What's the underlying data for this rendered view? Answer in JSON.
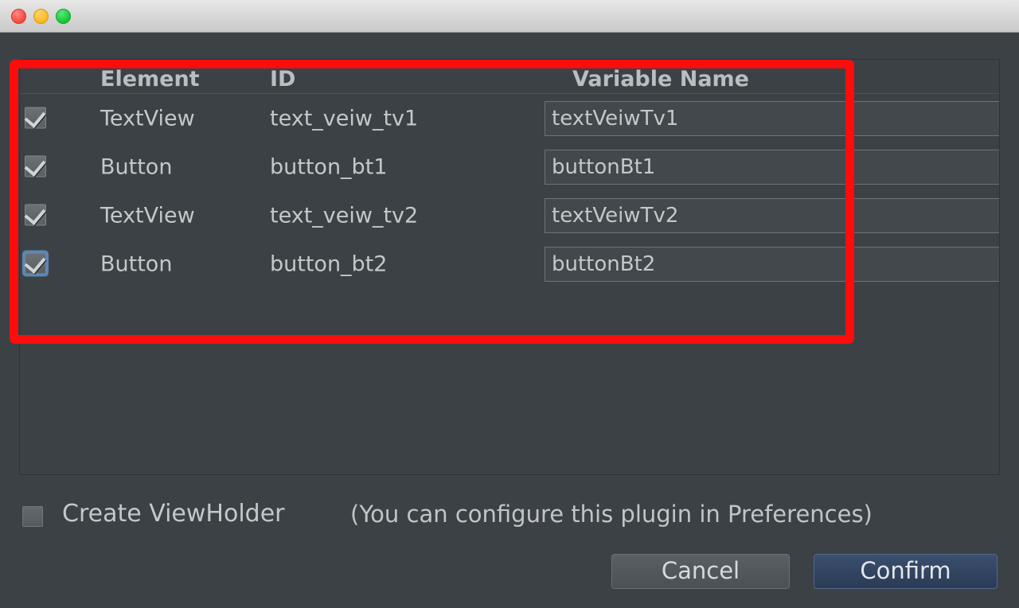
{
  "window": {
    "titlebar": {
      "close_label": "close",
      "minimize_label": "minimize",
      "zoom_label": "zoom"
    }
  },
  "table": {
    "columns": [
      "Element",
      "ID",
      "Variable Name"
    ],
    "rows": [
      {
        "checked": true,
        "focused": false,
        "element": "TextView",
        "id": "text_veiw_tv1",
        "variable": "textVeiwTv1"
      },
      {
        "checked": true,
        "focused": false,
        "element": "Button",
        "id": "button_bt1",
        "variable": "buttonBt1"
      },
      {
        "checked": true,
        "focused": false,
        "element": "TextView",
        "id": "text_veiw_tv2",
        "variable": "textVeiwTv2"
      },
      {
        "checked": true,
        "focused": true,
        "element": "Button",
        "id": "button_bt2",
        "variable": "buttonBt2"
      }
    ]
  },
  "options": {
    "create_viewholder_label": "Create ViewHolder",
    "create_viewholder_checked": false,
    "hint": "(You can configure this plugin in Preferences)"
  },
  "buttons": {
    "cancel_label": "Cancel",
    "confirm_label": "Confirm"
  },
  "annotation": {
    "color": "#fb0d0d"
  },
  "colors": {
    "dialog_background": "#3c4145",
    "text_primary": "#c3c8cb",
    "confirm_accent": "#2b3b55",
    "annotation_red": "#fb0d0d"
  }
}
